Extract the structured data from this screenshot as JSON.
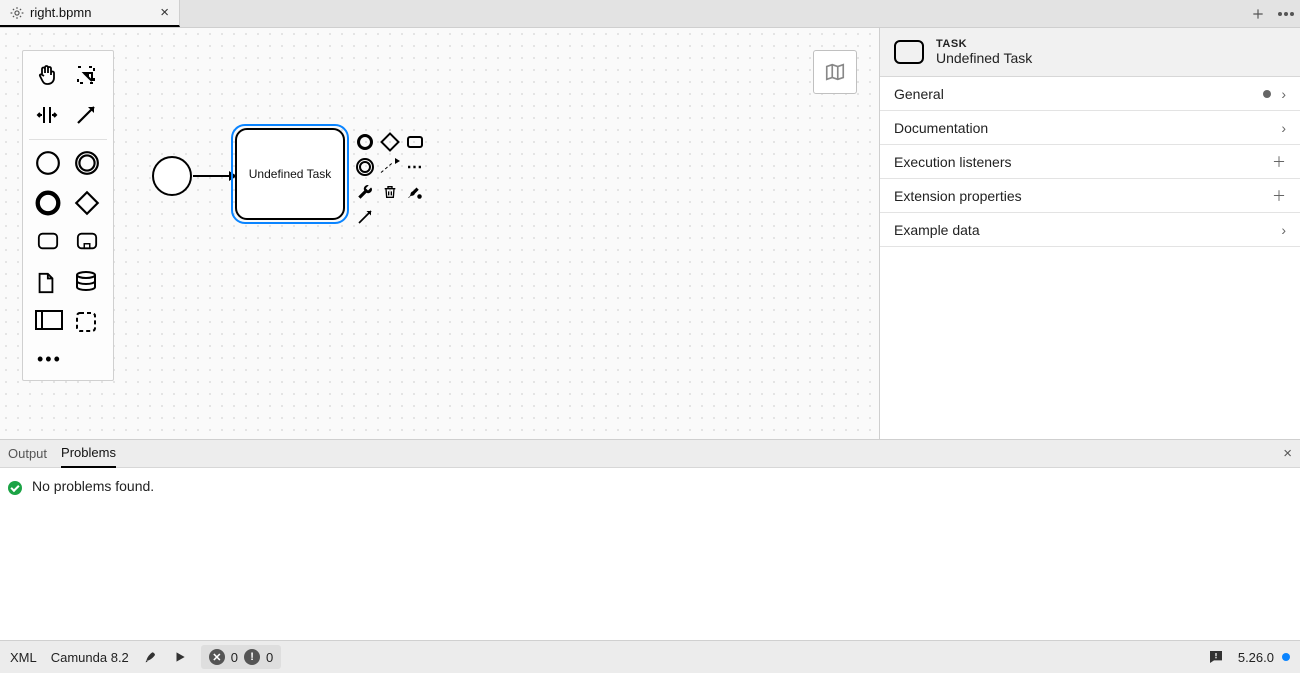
{
  "tab": {
    "filename": "right.bpmn"
  },
  "diagram": {
    "task_label": "Undefined Task"
  },
  "properties": {
    "type_label": "TASK",
    "name": "Undefined Task",
    "sections": {
      "general": "General",
      "documentation": "Documentation",
      "execution_listeners": "Execution listeners",
      "extension_properties": "Extension properties",
      "example_data": "Example data"
    }
  },
  "bottom_panel": {
    "tabs": {
      "output": "Output",
      "problems": "Problems"
    },
    "message": "No problems found."
  },
  "status_bar": {
    "xml": "XML",
    "platform": "Camunda 8.2",
    "errors": "0",
    "warnings": "0",
    "version": "5.26.0"
  }
}
